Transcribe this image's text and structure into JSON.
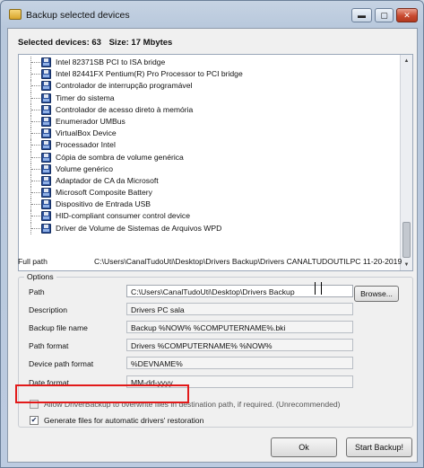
{
  "window": {
    "title": "Backup selected devices",
    "controls": {
      "minimize": "▬",
      "maximize": "▢",
      "close": "✕"
    }
  },
  "summary": {
    "devices": "Selected devices: 63",
    "size": "Size: 17 Mbytes"
  },
  "device_list": {
    "items": [
      "Intel 82371SB PCI to ISA bridge",
      "Intel 82441FX Pentium(R) Pro Processor to PCI bridge",
      "Controlador de interrupção programável",
      "Timer do sistema",
      "Controlador de acesso direto à memória",
      "Enumerador UMBus",
      "VirtualBox Device",
      "Processador Intel",
      "Cópia de sombra de volume genérica",
      "Volume genérico",
      "Adaptador de CA da Microsoft",
      "Microsoft Composite Battery",
      "Dispositivo de Entrada USB",
      "HID-compliant consumer control device",
      "Driver de Volume de Sistemas de Arquivos WPD"
    ],
    "scroll_up": "▲",
    "scroll_down": "▼"
  },
  "full_path": {
    "label": "Full path",
    "value": "C:\\Users\\CanalTudoUti\\Desktop\\Drivers Backup\\Drivers CANALTUDOUTILPC 11-20-2019"
  },
  "options": {
    "legend": "Options",
    "fields": [
      {
        "label": "Path",
        "value": "C:\\Users\\CanalTudoUti\\Desktop\\Drivers Backup"
      },
      {
        "label": "Description",
        "value": "Drivers PC sala"
      },
      {
        "label": "Backup file name",
        "value": "Backup %NOW%  %COMPUTERNAME%.bki"
      },
      {
        "label": "Path format",
        "value": "Drivers %COMPUTERNAME% %NOW%"
      },
      {
        "label": "Device path format",
        "value": "%DEVNAME%"
      },
      {
        "label": "Date format",
        "value": "MM-dd-yyyy"
      }
    ],
    "browse_label": "Browse...",
    "overwrite": {
      "label": "Allow DriverBackup to overwrite files in destination path, if required. (Unrecommended)",
      "checked": false
    },
    "auto_restore": {
      "label": "Generate files for automatic drivers' restoration",
      "checked": true,
      "check_glyph": "✔"
    }
  },
  "buttons": {
    "ok": "Ok",
    "start": "Start Backup!"
  },
  "colors": {
    "highlight": "#e21a1a",
    "title_bg": "#c6d3e3"
  }
}
